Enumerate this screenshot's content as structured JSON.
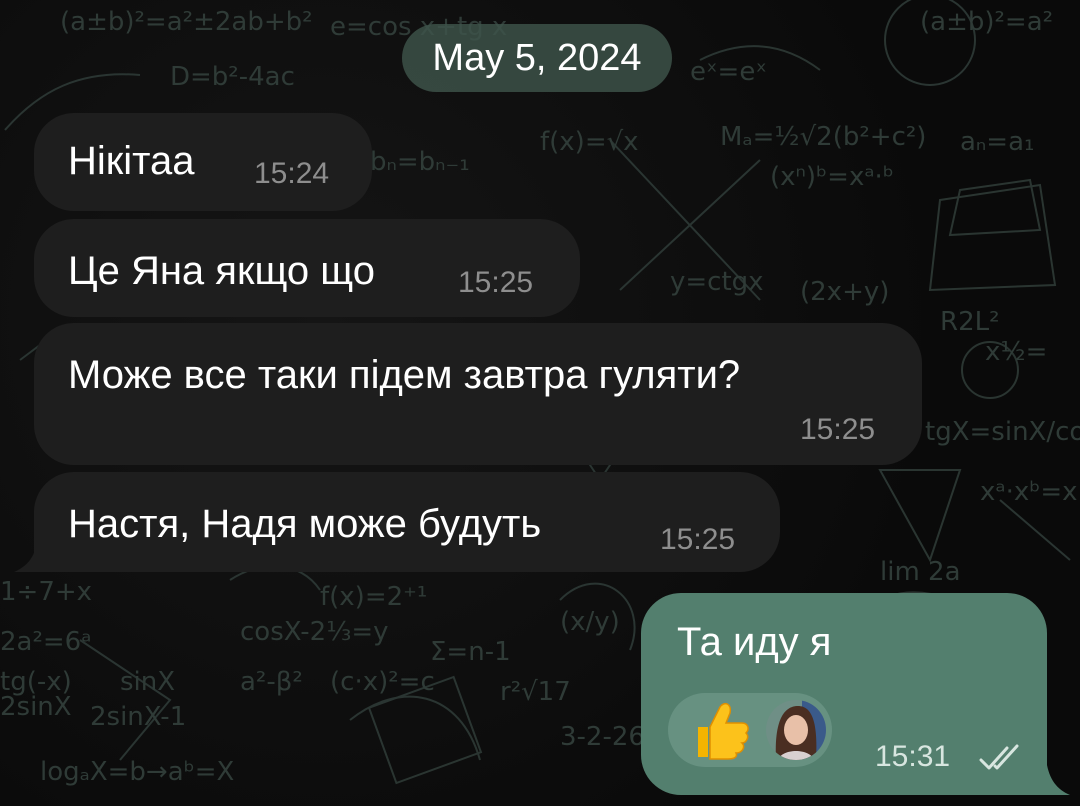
{
  "date_separator": "May 5, 2024",
  "incoming_messages": [
    {
      "text": "Нікітаа",
      "time": "15:24"
    },
    {
      "text": "Це Яна якщо що",
      "time": "15:25"
    },
    {
      "text": "Може все таки підем завтра гуляти?",
      "time": "15:25"
    },
    {
      "text": "Настя, Надя може будуть",
      "time": "15:25"
    }
  ],
  "outgoing_message": {
    "text": "Та иду я",
    "time": "15:31",
    "status_icon": "double-check-icon",
    "reaction": {
      "emoji_icon": "thumbs-up-icon",
      "reactor_avatar": "avatar"
    }
  },
  "colors": {
    "background": "#0b0b0b",
    "incoming_bubble": "#1e1e1e",
    "outgoing_bubble": "#537f6e",
    "date_pill": "#3e544a",
    "timestamp_incoming": "#8e8e8e"
  }
}
